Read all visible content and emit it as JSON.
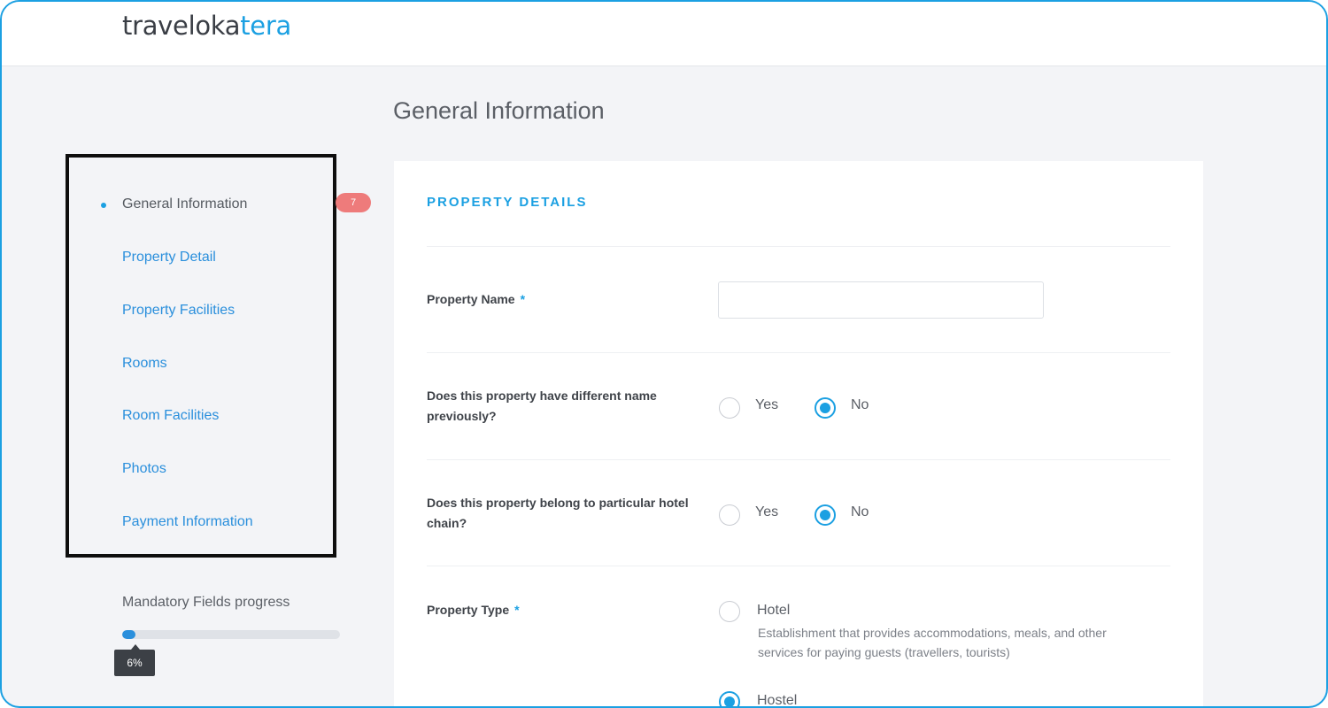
{
  "app": {
    "logo_primary": "traveloka",
    "logo_accent": "tera"
  },
  "page": {
    "title": "General Information"
  },
  "sidebar": {
    "items": [
      {
        "label": "General Information",
        "active": true
      },
      {
        "label": "Property Detail"
      },
      {
        "label": "Property Facilities"
      },
      {
        "label": "Rooms"
      },
      {
        "label": "Room Facilities"
      },
      {
        "label": "Photos"
      },
      {
        "label": "Payment Information"
      }
    ],
    "badge": "7",
    "progress_label": "Mandatory Fields progress",
    "progress_value": "6%",
    "progress_fraction": 0.06
  },
  "form": {
    "section_title": "PROPERTY DETAILS",
    "property_name": {
      "label": "Property Name",
      "required_mark": "*",
      "value": "",
      "placeholder": ""
    },
    "different_name": {
      "label": "Does this property have different name previously?",
      "options": [
        "Yes",
        "No"
      ],
      "selected": "No"
    },
    "hotel_chain": {
      "label": "Does this property belong to particular hotel chain?",
      "options": [
        "Yes",
        "No"
      ],
      "selected": "No"
    },
    "property_type": {
      "label": "Property Type",
      "required_mark": "*",
      "options": [
        {
          "label": "Hotel",
          "description": "Establishment that provides accommodations, meals, and other services for paying guests (travellers, tourists)"
        },
        {
          "label": "Hostel"
        }
      ],
      "selected": "Hostel"
    }
  },
  "colors": {
    "accent": "#1ba0e2",
    "badge": "#ee7b7b",
    "frame_border": "#1ba0e2"
  }
}
